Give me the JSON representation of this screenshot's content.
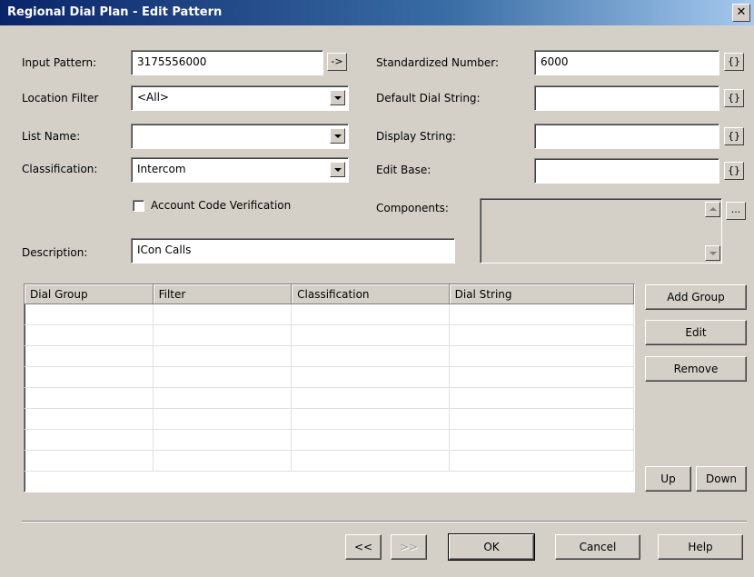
{
  "window": {
    "title": "Regional Dial Plan - Edit Pattern",
    "close_glyph": "✕"
  },
  "left": {
    "input_pattern_label": "Input Pattern:",
    "input_pattern_value": "3175556000",
    "arrow_button": "->",
    "location_filter_label": "Location Filter",
    "location_filter_value": "<All>",
    "list_name_label": "List Name:",
    "list_name_value": "",
    "classification_label": "Classification:",
    "classification_value": "Intercom",
    "account_code_label": "Account Code Verification",
    "account_code_checked": false,
    "description_label": "Description:",
    "description_value": "ICon Calls"
  },
  "right": {
    "standardized_label": "Standardized Number:",
    "standardized_value": "6000",
    "default_dial_label": "Default Dial String:",
    "default_dial_value": "",
    "display_string_label": "Display String:",
    "display_string_value": "",
    "edit_base_label": "Edit Base:",
    "edit_base_value": "",
    "components_label": "Components:",
    "brace_glyph": "{}",
    "ellipsis": "..."
  },
  "grid": {
    "columns": [
      "Dial Group",
      "Filter",
      "Classification",
      "Dial String"
    ],
    "rows": 8
  },
  "side_buttons": {
    "add_group": "Add Group",
    "edit": "Edit",
    "remove": "Remove",
    "up": "Up",
    "down": "Down"
  },
  "footer": {
    "back": "<<",
    "next": ">>",
    "ok": "OK",
    "cancel": "Cancel",
    "help": "Help"
  }
}
